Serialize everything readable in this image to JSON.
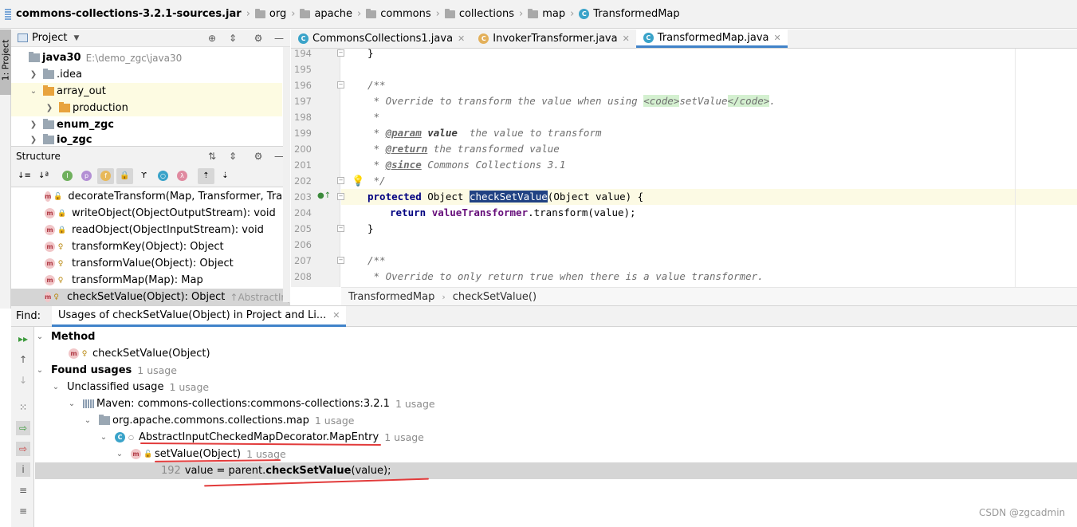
{
  "breadcrumb": [
    "commons-collections-3.2.1-sources.jar",
    "org",
    "apache",
    "commons",
    "collections",
    "map",
    "TransformedMap"
  ],
  "left_stripe": {
    "project_tab": "1: Project"
  },
  "project_panel": {
    "title": "Project",
    "tree": [
      {
        "label": "java30",
        "path": "E:\\demo_zgc\\java30"
      },
      {
        "label": ".idea"
      },
      {
        "label": "array_out"
      },
      {
        "label": "production"
      },
      {
        "label": "enum_zgc"
      },
      {
        "label": "io_zgc"
      }
    ]
  },
  "structure_panel": {
    "title": "Structure",
    "items": [
      {
        "label": "decorateTransform(Map, Transformer, Transfo"
      },
      {
        "label": "writeObject(ObjectOutputStream): void"
      },
      {
        "label": "readObject(ObjectInputStream): void"
      },
      {
        "label": "transformKey(Object): Object"
      },
      {
        "label": "transformValue(Object): Object"
      },
      {
        "label": "transformMap(Map): Map"
      },
      {
        "label": "checkSetValue(Object): Object",
        "extra": "↑AbstractInputCh"
      }
    ]
  },
  "editor": {
    "tabs": [
      {
        "label": "CommonsCollections1.java"
      },
      {
        "label": "InvokerTransformer.java"
      },
      {
        "label": "TransformedMap.java",
        "active": true
      }
    ],
    "lines": [
      {
        "num": "194",
        "code": "}"
      },
      {
        "num": "195",
        "code": ""
      },
      {
        "num": "196",
        "code": "/**"
      },
      {
        "num": "197",
        "pre": " * Override to transform the value when using ",
        "tag1": "<code>",
        "mid": "setValue",
        "tag2": "</code>",
        "post": "."
      },
      {
        "num": "198",
        "code": " *"
      },
      {
        "num": "199",
        "pre": " * ",
        "tag": "@param",
        "bold": " value",
        "post": "  the value to transform"
      },
      {
        "num": "200",
        "pre": " * ",
        "tag": "@return",
        "post": " the transformed value"
      },
      {
        "num": "201",
        "pre": " * ",
        "tag": "@since",
        "post": " Commons Collections 3.1"
      },
      {
        "num": "202",
        "code": " */"
      },
      {
        "num": "203",
        "kw": "protected",
        "t1": " Object ",
        "sel": "checkSetValue",
        "t2": "(Object value) {"
      },
      {
        "num": "204",
        "kw": "return",
        "field": "valueTransformer",
        "t2": ".transform(value);"
      },
      {
        "num": "205",
        "code": "}"
      },
      {
        "num": "206",
        "code": ""
      },
      {
        "num": "207",
        "code": "/**"
      },
      {
        "num": "208",
        "code": " * Override to only return true when there is a value transformer."
      }
    ],
    "crumb": [
      "TransformedMap",
      "checkSetValue()"
    ]
  },
  "find": {
    "label": "Find:",
    "tab": "Usages of checkSetValue(Object) in Project and Li...",
    "method_header": "Method",
    "method_item": "checkSetValue(Object)",
    "found_header": "Found usages",
    "found_count": "1 usage",
    "unclassified": "Unclassified usage",
    "unclassified_count": "1 usage",
    "maven": "Maven: commons-collections:commons-collections:3.2.1",
    "maven_count": "1 usage",
    "package": "org.apache.commons.collections.map",
    "package_count": "1 usage",
    "class_name": "AbstractInputCheckedMapDecorator.MapEntry",
    "class_count": "1 usage",
    "method_name": "setValue(Object)",
    "method_count": "1 usage",
    "usage_line_num": "192",
    "usage_pre": "value = parent.",
    "usage_bold": "checkSetValue",
    "usage_post": "(value);"
  },
  "watermark": "CSDN @zgcadmin",
  "colors": {
    "accent": "#4083c9",
    "selection": "#214283",
    "annotation": "#e23b3b"
  }
}
